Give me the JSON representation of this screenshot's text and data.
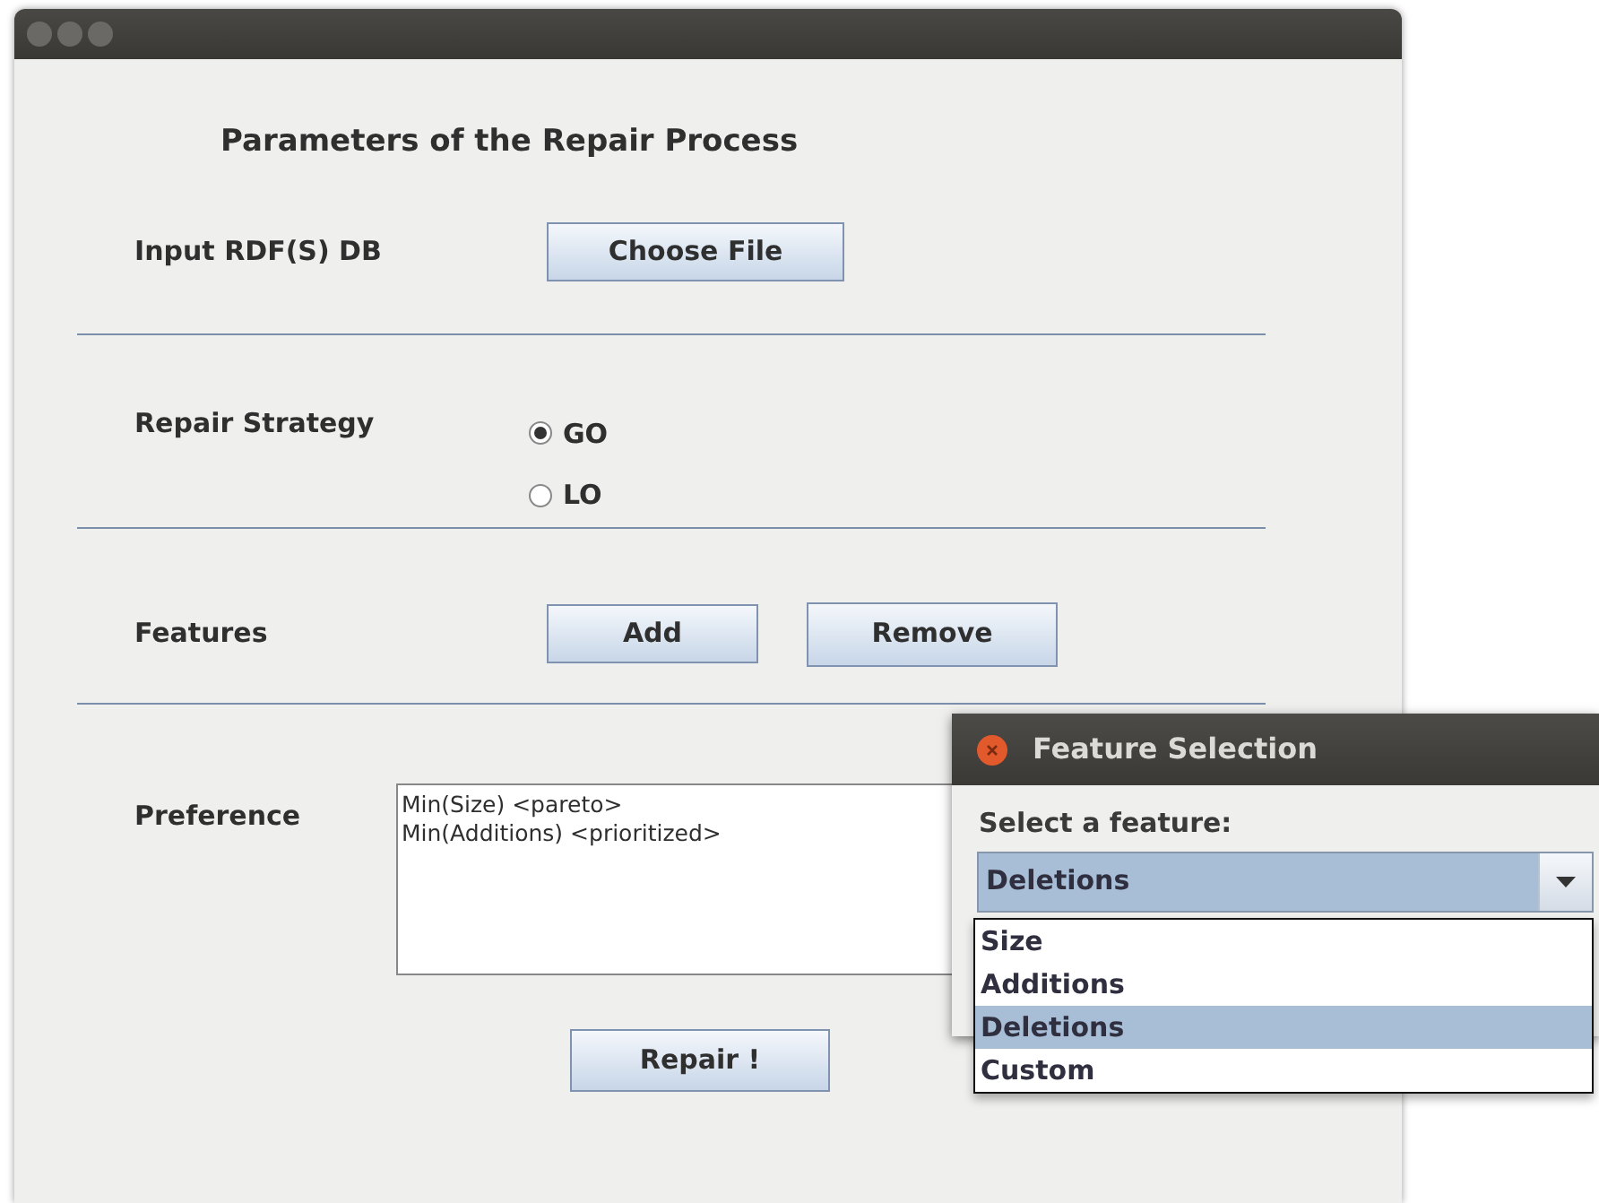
{
  "main_window": {
    "heading": "Parameters of the Repair Process",
    "input": {
      "label": "Input RDF(S) DB",
      "button": "Choose File"
    },
    "strategy": {
      "label": "Repair Strategy",
      "options": [
        {
          "label": "GO",
          "selected": true
        },
        {
          "label": "LO",
          "selected": false
        }
      ]
    },
    "features": {
      "label": "Features",
      "buttons": [
        "Add",
        "Remove"
      ]
    },
    "preference": {
      "label": "Preference",
      "lines": [
        "Min(Size) <pareto>",
        "Min(Additions) <prioritized>"
      ]
    },
    "repair_button": "Repair !"
  },
  "dialog": {
    "title": "Feature Selection",
    "label": "Select a feature:",
    "value": "Deletions",
    "options": [
      {
        "label": "Size",
        "selected": false
      },
      {
        "label": "Additions",
        "selected": false
      },
      {
        "label": "Deletions",
        "selected": true
      },
      {
        "label": "Custom",
        "selected": false
      }
    ]
  }
}
